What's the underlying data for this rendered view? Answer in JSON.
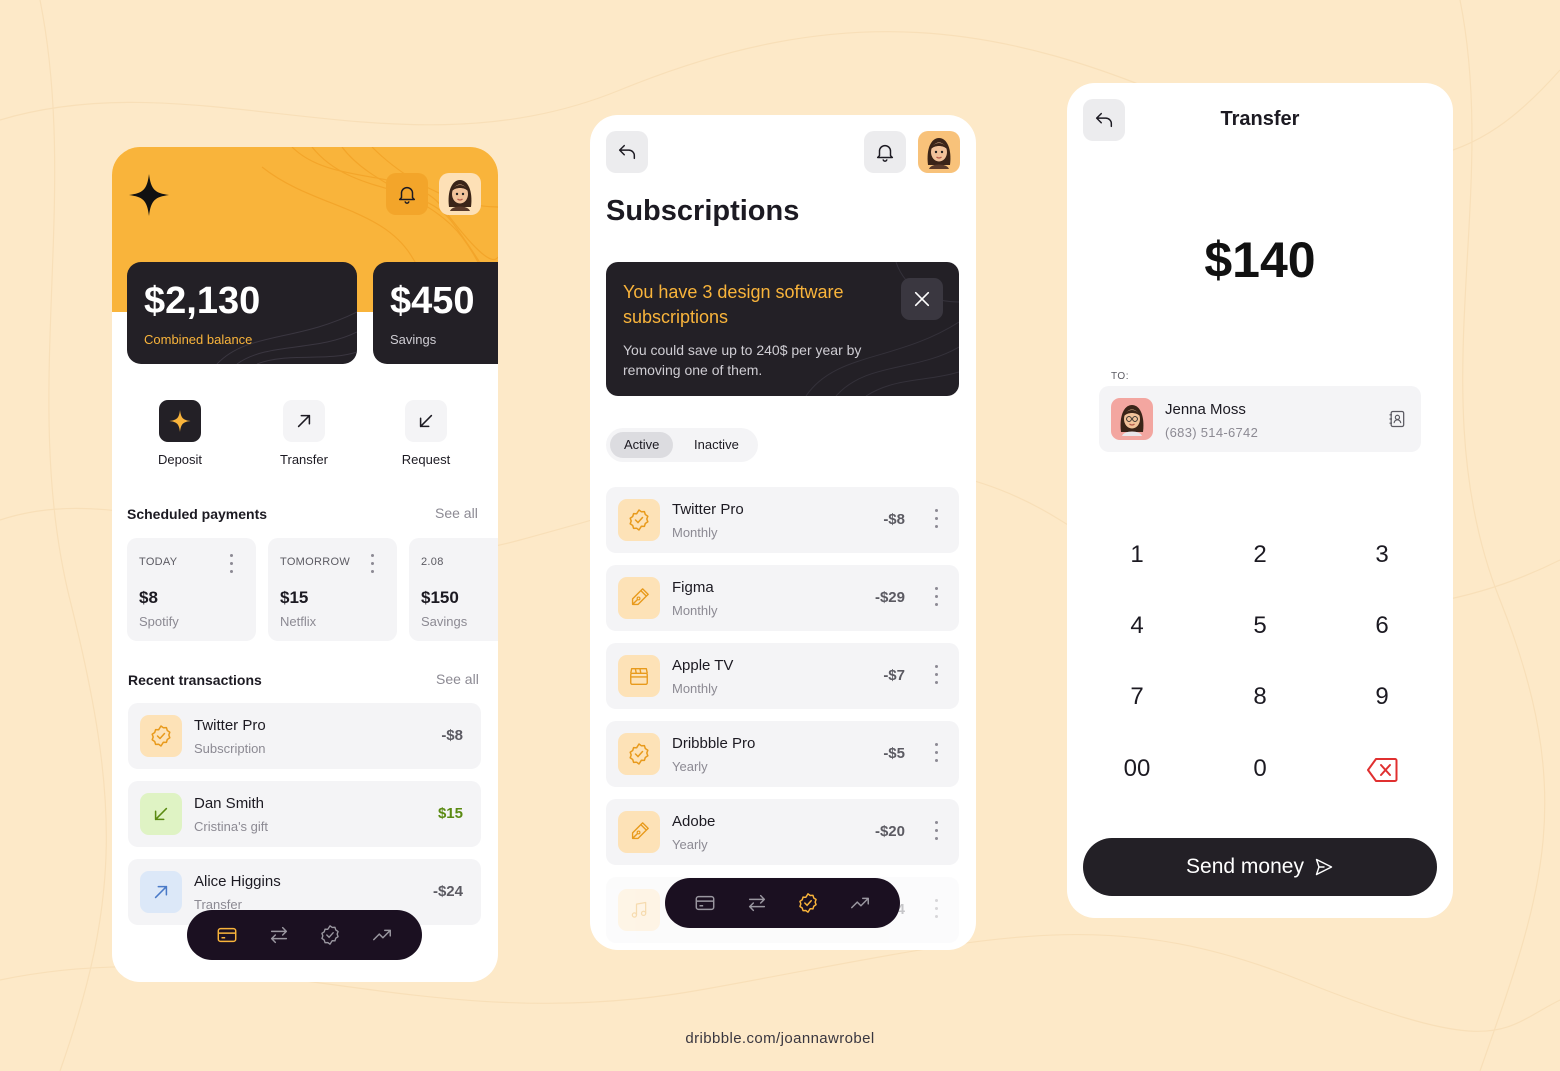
{
  "colors": {
    "background": "#fde9c8",
    "accent": "#f9b43b",
    "dark": "#232026",
    "nav": "#1b1021",
    "positive": "#5a8a12",
    "danger": "#e03030"
  },
  "home": {
    "balance": {
      "amount": "$2,130",
      "label": "Combined balance"
    },
    "savings": {
      "amount": "$450",
      "label": "Savings"
    },
    "actions": [
      {
        "label": "Deposit",
        "icon": "sparkle-icon"
      },
      {
        "label": "Transfer",
        "icon": "arrow-up-right-icon"
      },
      {
        "label": "Request",
        "icon": "arrow-down-left-icon"
      }
    ],
    "scheduled": {
      "title": "Scheduled payments",
      "see_all": "See all",
      "items": [
        {
          "when": "TODAY",
          "amount": "$8",
          "who": "Spotify"
        },
        {
          "when": "TOMORROW",
          "amount": "$15",
          "who": "Netflix"
        },
        {
          "when": "2.08",
          "amount": "$150",
          "who": "Savings"
        }
      ]
    },
    "recent": {
      "title": "Recent transactions",
      "see_all": "See all",
      "items": [
        {
          "name": "Twitter Pro",
          "sub": "Subscription",
          "amount": "-$8",
          "icon": "verified-badge-icon"
        },
        {
          "name": "Dan Smith",
          "sub": "Cristina's gift",
          "amount": "$15",
          "icon": "arrow-down-left-icon"
        },
        {
          "name": "Alice Higgins",
          "sub": "Transfer",
          "amount": "-$24",
          "icon": "arrow-up-right-icon"
        }
      ]
    }
  },
  "subscriptions": {
    "title": "Subscriptions",
    "banner": {
      "heading": "You have 3 design software subscriptions",
      "body": "You could save up to 240$ per year by removing one of them."
    },
    "tabs": {
      "active": "Active",
      "inactive": "Inactive"
    },
    "items": [
      {
        "name": "Twitter Pro",
        "period": "Monthly",
        "amount": "-$8",
        "icon": "verified-badge-icon"
      },
      {
        "name": "Figma",
        "period": "Monthly",
        "amount": "-$29",
        "icon": "pen-tool-icon"
      },
      {
        "name": "Apple TV",
        "period": "Monthly",
        "amount": "-$7",
        "icon": "clapperboard-icon"
      },
      {
        "name": "Dribbble Pro",
        "period": "Yearly",
        "amount": "-$5",
        "icon": "verified-badge-icon"
      },
      {
        "name": "Adobe",
        "period": "Yearly",
        "amount": "-$20",
        "icon": "pen-tool-icon"
      }
    ],
    "peek_amount": "-$4"
  },
  "transfer": {
    "title": "Transfer",
    "amount": "$140",
    "to_label": "TO:",
    "recipient": {
      "name": "Jenna Moss",
      "phone": "(683) 514-6742"
    },
    "keys": [
      "1",
      "2",
      "3",
      "4",
      "5",
      "6",
      "7",
      "8",
      "9",
      "00",
      "0"
    ],
    "send_label": "Send money"
  },
  "footer": "dribbble.com/joannawrobel"
}
